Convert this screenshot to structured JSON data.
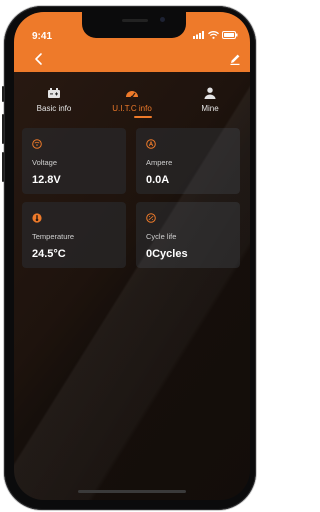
{
  "status_bar": {
    "time": "9:41"
  },
  "tabs": [
    {
      "label": "Basic info",
      "icon": "battery-icon",
      "active": false
    },
    {
      "label": "U.I.T.C info",
      "icon": "gauge-icon",
      "active": true
    },
    {
      "label": "Mine",
      "icon": "person-icon",
      "active": false
    }
  ],
  "cards": [
    {
      "label": "Voltage",
      "value": "12.8V",
      "icon": "voltage-icon"
    },
    {
      "label": "Ampere",
      "value": "0.0A",
      "icon": "ampere-icon"
    },
    {
      "label": "Temperature",
      "value": "24.5°C",
      "icon": "temperature-icon"
    },
    {
      "label": "Cycle life",
      "value": "0Cycles",
      "icon": "cycle-icon"
    }
  ],
  "colors": {
    "accent": "#ee7a2a",
    "card": "#282628",
    "background": "#1a110c"
  }
}
